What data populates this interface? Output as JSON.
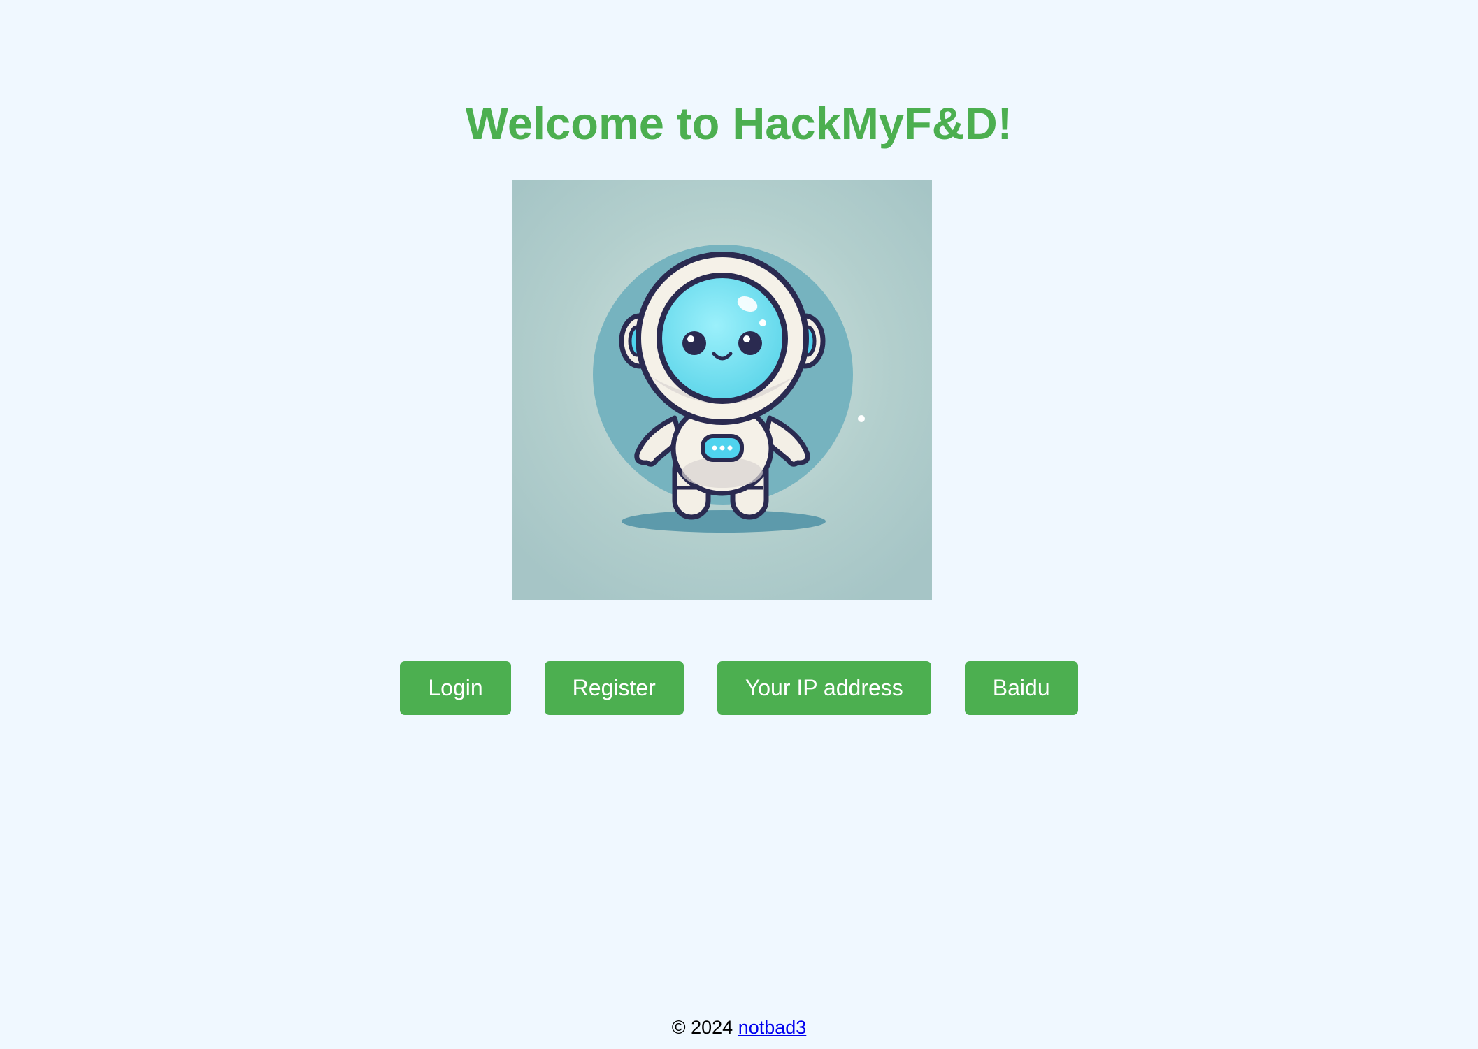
{
  "header": {
    "title": "Welcome to HackMyF&D!"
  },
  "hero": {
    "icon": "astronaut-robot-mascot"
  },
  "nav": {
    "buttons": [
      {
        "label": "Login"
      },
      {
        "label": "Register"
      },
      {
        "label": "Your IP address"
      },
      {
        "label": "Baidu"
      }
    ]
  },
  "footer": {
    "copyright": "© 2024",
    "author_link": "notbad3"
  },
  "colors": {
    "background": "#f0f8ff",
    "accent": "#4caf50",
    "link": "#0000ee"
  }
}
